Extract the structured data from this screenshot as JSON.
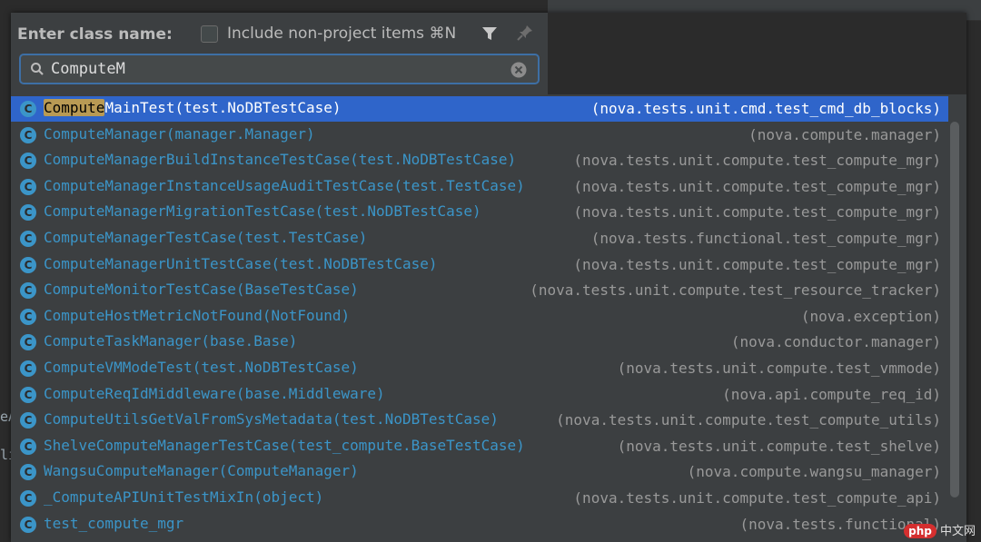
{
  "dialog": {
    "label": "Enter class name:",
    "checkbox_label": "Include non-project items ⌘N",
    "checkbox_checked": false,
    "search_value": "ComputeM",
    "search_placeholder": ""
  },
  "results": [
    {
      "highlight": "Compute",
      "rest": "MainTest(test.NoDBTestCase)",
      "location": "(nova.tests.unit.cmd.test_cmd_db_blocks)",
      "selected": true
    },
    {
      "highlight": "",
      "rest": "ComputeManager(manager.Manager)",
      "location": "(nova.compute.manager)"
    },
    {
      "highlight": "",
      "rest": "ComputeManagerBuildInstanceTestCase(test.NoDBTestCase)",
      "location": "(nova.tests.unit.compute.test_compute_mgr)"
    },
    {
      "highlight": "",
      "rest": "ComputeManagerInstanceUsageAuditTestCase(test.TestCase)",
      "location": "(nova.tests.unit.compute.test_compute_mgr)"
    },
    {
      "highlight": "",
      "rest": "ComputeManagerMigrationTestCase(test.NoDBTestCase)",
      "location": "(nova.tests.unit.compute.test_compute_mgr)"
    },
    {
      "highlight": "",
      "rest": "ComputeManagerTestCase(test.TestCase)",
      "location": "(nova.tests.functional.test_compute_mgr)"
    },
    {
      "highlight": "",
      "rest": "ComputeManagerUnitTestCase(test.NoDBTestCase)",
      "location": "(nova.tests.unit.compute.test_compute_mgr)"
    },
    {
      "highlight": "",
      "rest": "ComputeMonitorTestCase(BaseTestCase)",
      "location": "(nova.tests.unit.compute.test_resource_tracker)"
    },
    {
      "highlight": "",
      "rest": "ComputeHostMetricNotFound(NotFound)",
      "location": "(nova.exception)"
    },
    {
      "highlight": "",
      "rest": "ComputeTaskManager(base.Base)",
      "location": "(nova.conductor.manager)"
    },
    {
      "highlight": "",
      "rest": "ComputeVMModeTest(test.NoDBTestCase)",
      "location": "(nova.tests.unit.compute.test_vmmode)"
    },
    {
      "highlight": "",
      "rest": "ComputeReqIdMiddleware(base.Middleware)",
      "location": "(nova.api.compute_req_id)"
    },
    {
      "highlight": "",
      "rest": "ComputeUtilsGetValFromSysMetadata(test.NoDBTestCase)",
      "location": "(nova.tests.unit.compute.test_compute_utils)"
    },
    {
      "highlight": "",
      "rest": "ShelveComputeManagerTestCase(test_compute.BaseTestCase)",
      "location": "(nova.tests.unit.compute.test_shelve)"
    },
    {
      "highlight": "",
      "rest": "WangsuComputeManager(ComputeManager)",
      "location": "(nova.compute.wangsu_manager)"
    },
    {
      "highlight": "",
      "rest": "_ComputeAPIUnitTestMixIn(object)",
      "location": "(nova.tests.unit.compute.test_compute_api)"
    },
    {
      "highlight": "",
      "rest": "test_compute_mgr",
      "location": "(nova.tests.functional)"
    }
  ],
  "icon_letter": "C",
  "gutter": {
    "frag1": "eA",
    "frag2": "li"
  },
  "watermark": {
    "badge": "php",
    "text": "中文网"
  },
  "colors": {
    "accent": "#3b95c8",
    "selection": "#2f65ca",
    "match_highlight": "#b99a54"
  }
}
